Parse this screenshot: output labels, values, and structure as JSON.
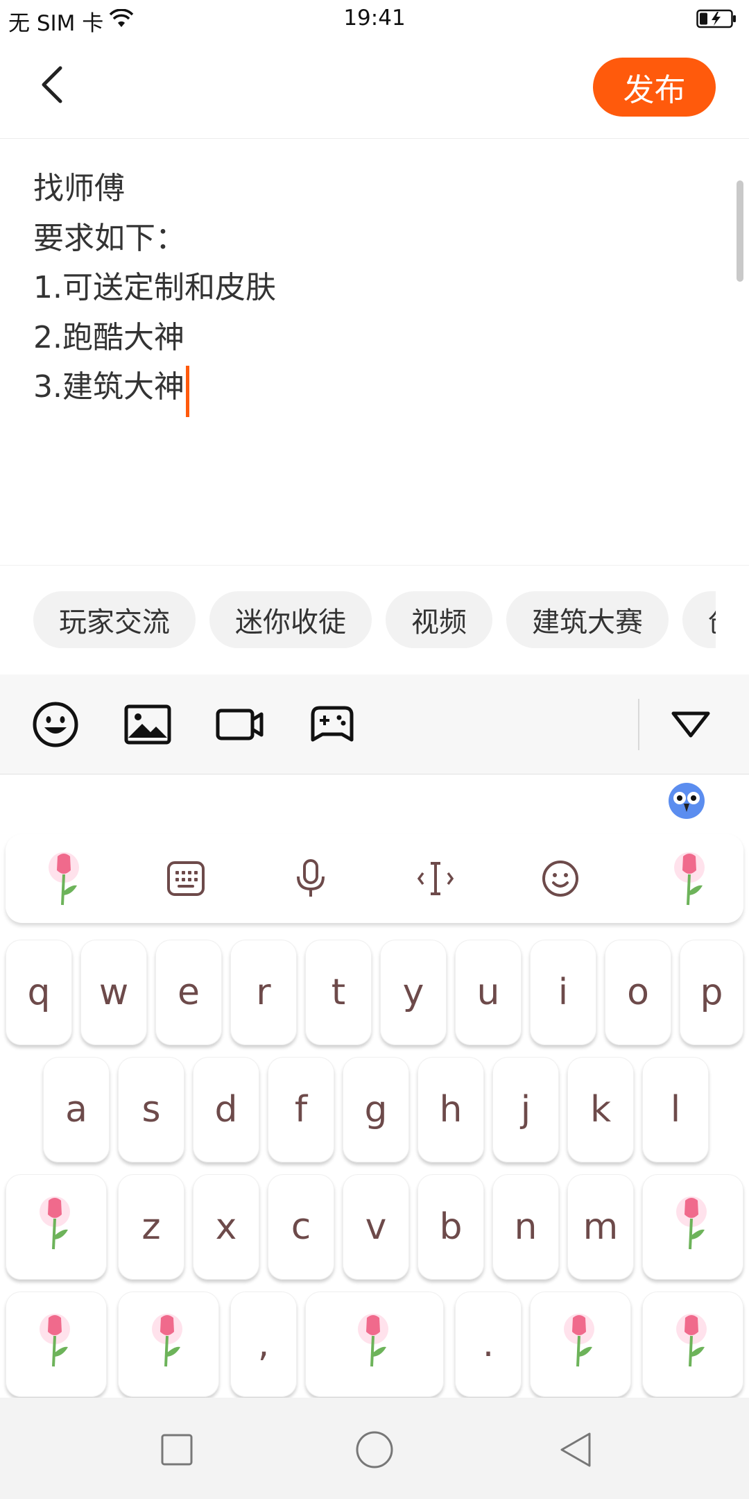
{
  "status_bar": {
    "carrier": "无 SIM 卡",
    "time": "19:41",
    "wifi_icon": "wifi-icon",
    "battery_icon": "battery-charging-icon"
  },
  "header": {
    "back_icon": "back-arrow-icon",
    "publish_label": "发布",
    "accent_color": "#ff5a0c"
  },
  "editor": {
    "lines": [
      "找师傅",
      "要求如下：",
      "1.可送定制和皮肤",
      "2.跑酷大神",
      "3.建筑大神"
    ]
  },
  "tags": [
    "玩家交流",
    "迷你收徒",
    "视频",
    "建筑大赛",
    "创"
  ],
  "toolbar": {
    "icons": [
      "emoji-icon",
      "image-icon",
      "video-icon",
      "gamepad-icon",
      "collapse-triangle-icon"
    ]
  },
  "keyboard": {
    "tools": [
      "tulip-icon",
      "keyboard-icon",
      "microphone-icon",
      "cursor-icon",
      "emoji-icon",
      "tulip-icon"
    ],
    "row1": [
      "q",
      "w",
      "e",
      "r",
      "t",
      "y",
      "u",
      "i",
      "o",
      "p"
    ],
    "row2": [
      "a",
      "s",
      "d",
      "f",
      "g",
      "h",
      "j",
      "k",
      "l"
    ],
    "row3": [
      "z",
      "x",
      "c",
      "v",
      "b",
      "n",
      "m"
    ],
    "row4_punct": [
      ",",
      "."
    ],
    "key_text_color": "#6d4a4a"
  },
  "navbar": {
    "icons": [
      "recents-square-icon",
      "home-circle-icon",
      "back-triangle-icon"
    ]
  }
}
